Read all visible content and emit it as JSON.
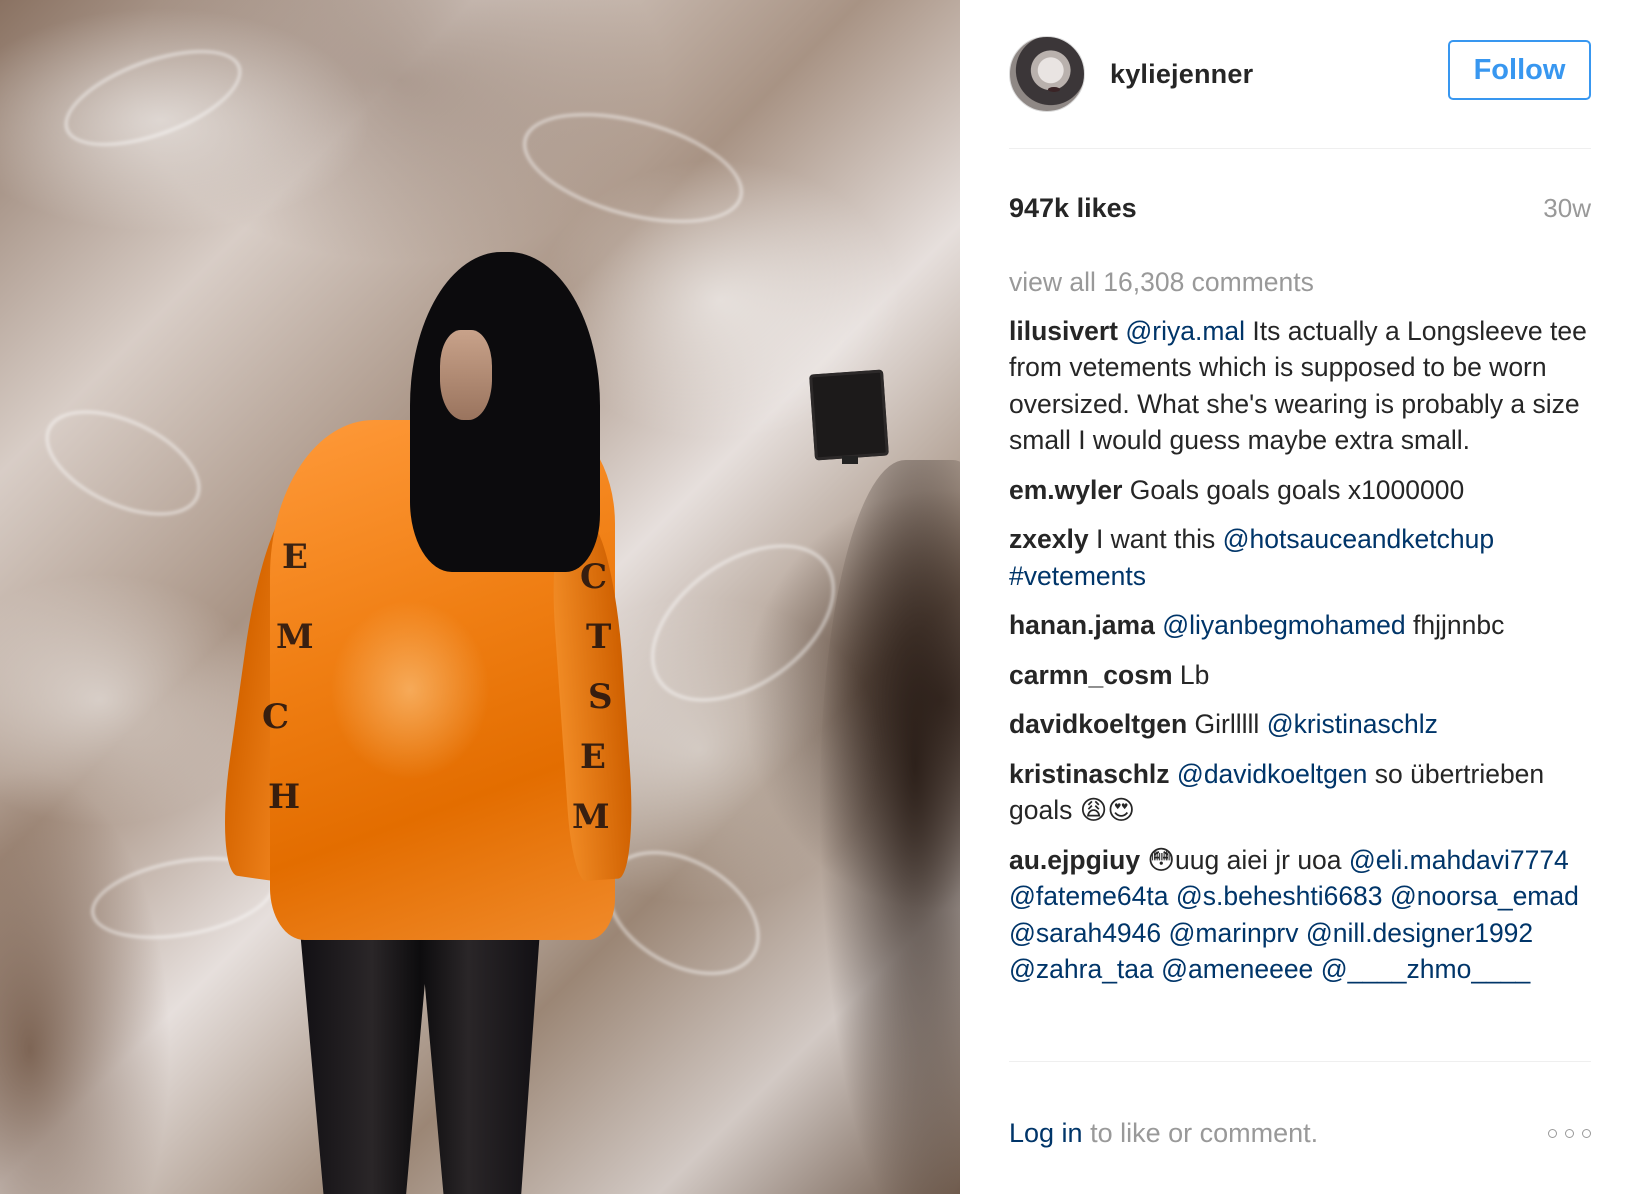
{
  "post": {
    "username": "kyliejenner",
    "follow_label": "Follow",
    "likes": "947k likes",
    "time_ago": "30w",
    "view_all_comments": "view all 16,308 comments",
    "login_link": "Log in",
    "login_suffix": " to like or comment."
  },
  "comments": [
    {
      "user": "lilusivert",
      "parts": [
        {
          "t": " "
        },
        {
          "m": "@riya.mal"
        },
        {
          "t": " Its actually a Longsleeve tee from vetements which is supposed to be worn oversized. What she's wearing is probably a size small I would guess maybe extra small."
        }
      ]
    },
    {
      "user": "em.wyler",
      "parts": [
        {
          "t": " Goals goals goals x1000000"
        }
      ]
    },
    {
      "user": "zxexly",
      "parts": [
        {
          "t": " I want this "
        },
        {
          "m": "@hotsauceandketchup"
        },
        {
          "t": " "
        },
        {
          "m": "#vetements"
        }
      ]
    },
    {
      "user": "hanan.jama",
      "parts": [
        {
          "t": " "
        },
        {
          "m": "@liyanbegmohamed"
        },
        {
          "t": " fhjjnnbc"
        }
      ]
    },
    {
      "user": "carmn_cosm",
      "parts": [
        {
          "t": " Lb"
        }
      ]
    },
    {
      "user": "davidkoeltgen",
      "parts": [
        {
          "t": " Girlllll "
        },
        {
          "m": "@kristinaschlz"
        }
      ]
    },
    {
      "user": "kristinaschlz",
      "parts": [
        {
          "t": " "
        },
        {
          "m": "@davidkoeltgen"
        },
        {
          "t": " so übertrieben goals 😩😍"
        }
      ]
    },
    {
      "user": "au.ejpgiuy",
      "parts": [
        {
          "t": " 😳uug aiei jr uoa "
        },
        {
          "m": "@eli.mahdavi7774"
        },
        {
          "t": " "
        },
        {
          "m": "@fateme64ta"
        },
        {
          "t": " "
        },
        {
          "m": "@s.beheshti6683"
        },
        {
          "t": " "
        },
        {
          "m": "@noorsa_emad"
        },
        {
          "t": " "
        },
        {
          "m": "@sarah4946"
        },
        {
          "t": " "
        },
        {
          "m": "@marinprv"
        },
        {
          "t": " "
        },
        {
          "m": "@nill.designer1992"
        },
        {
          "t": " "
        },
        {
          "m": "@zahra_taa"
        },
        {
          "t": " "
        },
        {
          "m": "@ameneeee"
        },
        {
          "t": " "
        },
        {
          "m": "@____zhmo____"
        }
      ]
    }
  ],
  "photo": {
    "print_glyphs_left": [
      "E",
      "M",
      "C",
      "H"
    ],
    "print_glyphs_right": [
      "C",
      "T",
      "S",
      "E",
      "M"
    ]
  },
  "icons": {
    "more": "more-options-icon",
    "avatar": "profile-avatar"
  },
  "colors": {
    "accent": "#3897f0",
    "mention": "#003569",
    "muted": "#999999",
    "text": "#262626"
  }
}
